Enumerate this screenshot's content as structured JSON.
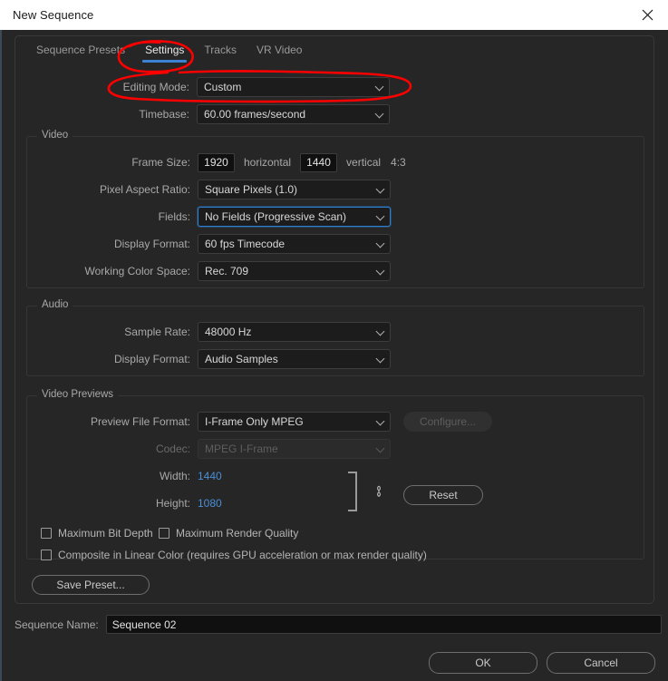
{
  "window": {
    "title": "New Sequence",
    "close_icon": "close-icon"
  },
  "tabs": [
    {
      "label": "Sequence Presets",
      "active": false
    },
    {
      "label": "Settings",
      "active": true
    },
    {
      "label": "Tracks",
      "active": false
    },
    {
      "label": "VR Video",
      "active": false
    }
  ],
  "top_settings": {
    "editing_mode_label": "Editing Mode:",
    "editing_mode_value": "Custom",
    "timebase_label": "Timebase:",
    "timebase_value": "60.00  frames/second"
  },
  "video": {
    "group_title": "Video",
    "frame_size_label": "Frame Size:",
    "frame_width": "1920",
    "horizontal_label": "horizontal",
    "frame_height": "1440",
    "vertical_label": "vertical",
    "aspect_ratio_text": "4:3",
    "pixel_aspect_label": "Pixel Aspect Ratio:",
    "pixel_aspect_value": "Square Pixels (1.0)",
    "fields_label": "Fields:",
    "fields_value": "No Fields (Progressive Scan)",
    "display_format_label": "Display Format:",
    "display_format_value": "60 fps Timecode",
    "color_space_label": "Working Color Space:",
    "color_space_value": "Rec. 709"
  },
  "audio": {
    "group_title": "Audio",
    "sample_rate_label": "Sample Rate:",
    "sample_rate_value": "48000 Hz",
    "display_format_label": "Display Format:",
    "display_format_value": "Audio Samples"
  },
  "video_previews": {
    "group_title": "Video Previews",
    "preview_file_format_label": "Preview File Format:",
    "preview_file_format_value": "I-Frame Only MPEG",
    "configure_label": "Configure...",
    "codec_label": "Codec:",
    "codec_value": "MPEG I-Frame",
    "width_label": "Width:",
    "width_value": "1440",
    "height_label": "Height:",
    "height_value": "1080",
    "link_icon": "chain-link-icon",
    "reset_label": "Reset"
  },
  "checkboxes": [
    {
      "label": "Maximum Bit Depth",
      "checked": false
    },
    {
      "label": "Maximum Render Quality",
      "checked": false
    },
    {
      "label": "Composite in Linear Color (requires GPU acceleration or max render quality)",
      "checked": false
    }
  ],
  "save_preset_label": "Save Preset...",
  "footer": {
    "sequence_name_label": "Sequence Name:",
    "sequence_name_value": "Sequence 02",
    "ok_label": "OK",
    "cancel_label": "Cancel"
  },
  "annotations": {
    "color": "#ff0000",
    "marks": [
      {
        "name": "settings-tab-circle",
        "shape": "ellipse"
      },
      {
        "name": "editing-mode-circle",
        "shape": "ellipse"
      }
    ]
  },
  "colors": {
    "accent_blue": "#3b82d4",
    "link_blue": "#4a8fd6",
    "annotation_red": "#ff0000",
    "dialog_bg": "#262626",
    "titlebar_bg": "#ffffff"
  }
}
